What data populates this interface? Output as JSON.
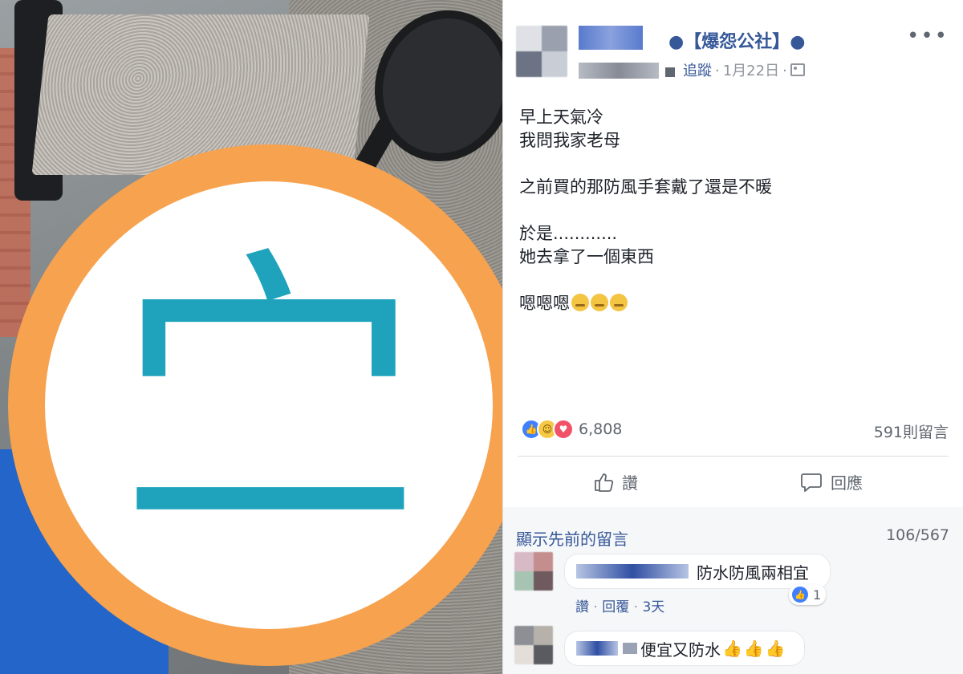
{
  "post": {
    "group_name": "●【爆怨公社】●",
    "follow_label": "追蹤",
    "date": "1月22日",
    "more_label": "•••",
    "lines": [
      "早上天氣冷",
      "我問我家老母",
      "",
      "之前買的那防風手套戴了還是不暖",
      "",
      "於是............",
      "她去拿了一個東西",
      "",
      "嗯嗯嗯"
    ],
    "reaction_count": "6,808",
    "comment_count": "591則留言",
    "like_label": "讚",
    "reply_label": "回應"
  },
  "photo": {
    "mosaic_char": "㝉"
  },
  "comments": {
    "show_previous": "顯示先前的留言",
    "page_count": "106/567",
    "items": [
      {
        "text": "防水防風兩相宜",
        "like_link": "讚",
        "reply_link": "回覆",
        "time": "3天",
        "likes": "1"
      },
      {
        "text": "便宜又防水"
      }
    ]
  },
  "colors": {
    "link": "#365899",
    "like": "#4080ff",
    "badge_ring": "#f7a24e",
    "badge_char": "#1fa3bd"
  }
}
